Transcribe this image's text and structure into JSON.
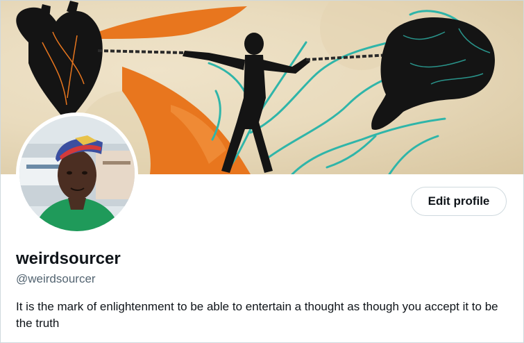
{
  "profile": {
    "display_name": "weirdsourcer",
    "handle": "@weirdsourcer",
    "bio": "It is the mark of enlightenment to be able to entertain a thought as though you accept it to be the truth"
  },
  "actions": {
    "edit_profile_label": "Edit profile"
  },
  "colors": {
    "text_primary": "#0f1419",
    "text_secondary": "#536471",
    "border": "#cfd9de",
    "banner_orange": "#e8761e",
    "banner_teal": "#2fb5a9",
    "banner_background": "#eadcbd"
  }
}
